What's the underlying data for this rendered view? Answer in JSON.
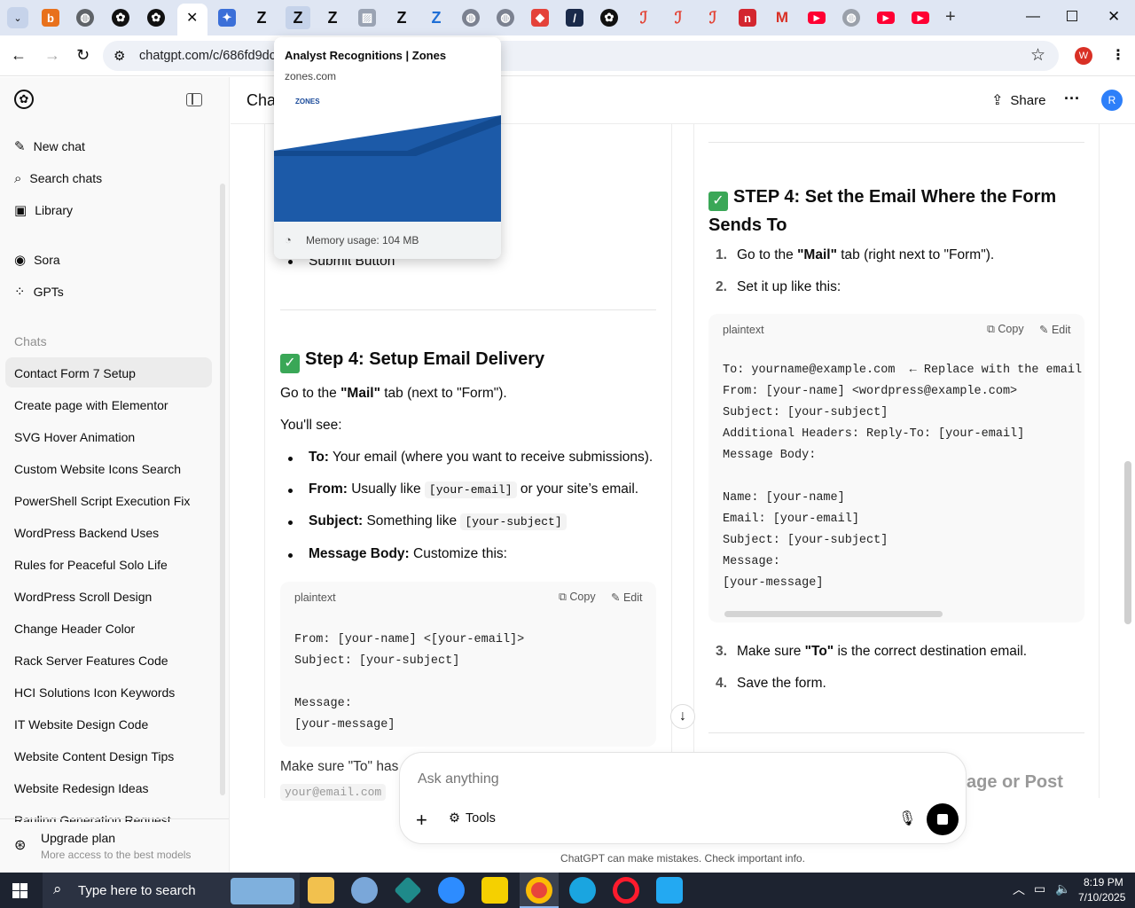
{
  "browser": {
    "url": "chatgpt.com/c/686fd9dc",
    "profile_initial": "W",
    "hover_card": {
      "title": "Analyst Recognitions | Zones",
      "domain": "zones.com",
      "thumb_logo": "ZONES",
      "memory": "Memory usage: 104 MB"
    }
  },
  "sidebar": {
    "nav": [
      {
        "label": "New chat",
        "icon": "pencil-square-icon"
      },
      {
        "label": "Search chats",
        "icon": "search-icon"
      },
      {
        "label": "Library",
        "icon": "library-icon"
      }
    ],
    "apps": [
      {
        "label": "Sora",
        "icon": "play-circle-icon"
      },
      {
        "label": "GPTs",
        "icon": "grid-icon"
      }
    ],
    "section_label": "Chats",
    "chats": [
      "Contact Form 7 Setup",
      "Create page with Elementor",
      "SVG Hover Animation",
      "Custom Website Icons Search",
      "PowerShell Script Execution Fix",
      "WordPress Backend Uses",
      "Rules for Peaceful Solo Life",
      "WordPress Scroll Design",
      "Change Header Color",
      "Rack Server Features Code",
      "HCI Solutions Icon Keywords",
      "IT Website Design Code",
      "Website Content Design Tips",
      "Website Redesign Ideas",
      "Rauling Generation Request"
    ],
    "upgrade": {
      "title": "Upgrade plan",
      "subtitle": "More access to the best models"
    }
  },
  "header": {
    "title": "Cha",
    "share": "Share",
    "avatar": "R"
  },
  "left_col": {
    "submit_item": "Submit Button",
    "step_heading": "Step 4: Setup Email Delivery",
    "intro_pre": "Go to the ",
    "intro_bold": "\"Mail\"",
    "intro_post": " tab (next to \"Form\").",
    "youll_see": "You'll see:",
    "bullets": [
      {
        "bold": "To:",
        "text": " Your email (where you want to receive submissions)."
      },
      {
        "bold": "From:",
        "text": " Usually like ",
        "code": "[your-email]",
        "after": " or your site’s email."
      },
      {
        "bold": "Subject:",
        "text": " Something like ",
        "code": "[your-subject]"
      },
      {
        "bold": "Message Body:",
        "text": " Customize this:"
      }
    ],
    "code": {
      "lang": "plaintext",
      "copy": "Copy",
      "edit": "Edit",
      "lines": "From: [your-name] <[your-email]>\nSubject: [your-subject]\n\nMessage:\n[your-message]"
    },
    "footer_text": "Make sure \"To\" has",
    "footer_code": "your@email.com"
  },
  "right_col": {
    "step_heading": "STEP 4: Set the Email Where the Form Sends To",
    "steps_a": [
      {
        "num": "1.",
        "pre": "Go to the ",
        "bold": "\"Mail\"",
        "post": " tab (right next to \"Form\")."
      },
      {
        "num": "2.",
        "pre": "Set it up like this:",
        "bold": "",
        "post": ""
      }
    ],
    "code": {
      "lang": "plaintext",
      "copy": "Copy",
      "edit": "Edit",
      "lines": "To: yourname@example.com  ← Replace with the email yo\nFrom: [your-name] <wordpress@example.com>\nSubject: [your-subject]\nAdditional Headers: Reply-To: [your-email]\nMessage Body:\n\nName: [your-name]\nEmail: [your-email]\nSubject: [your-subject]\nMessage:\n[your-message]"
    },
    "steps_b": [
      {
        "num": "3.",
        "pre": "Make sure ",
        "bold": "\"To\"",
        "post": " is the correct destination email."
      },
      {
        "num": "4.",
        "pre": "Save the form.",
        "bold": "",
        "post": ""
      }
    ],
    "cutoff": "age or Post"
  },
  "composer": {
    "placeholder": "Ask anything",
    "tools": "Tools",
    "disclaimer": "ChatGPT can make mistakes. Check important info."
  },
  "taskbar": {
    "search_placeholder": "Type here to search",
    "time": "8:19 PM",
    "date": "7/10/2025"
  },
  "colors": {
    "accent": "#3aa757",
    "taskbar": "#1d2330",
    "tabstrip": "#dfe6f3"
  }
}
